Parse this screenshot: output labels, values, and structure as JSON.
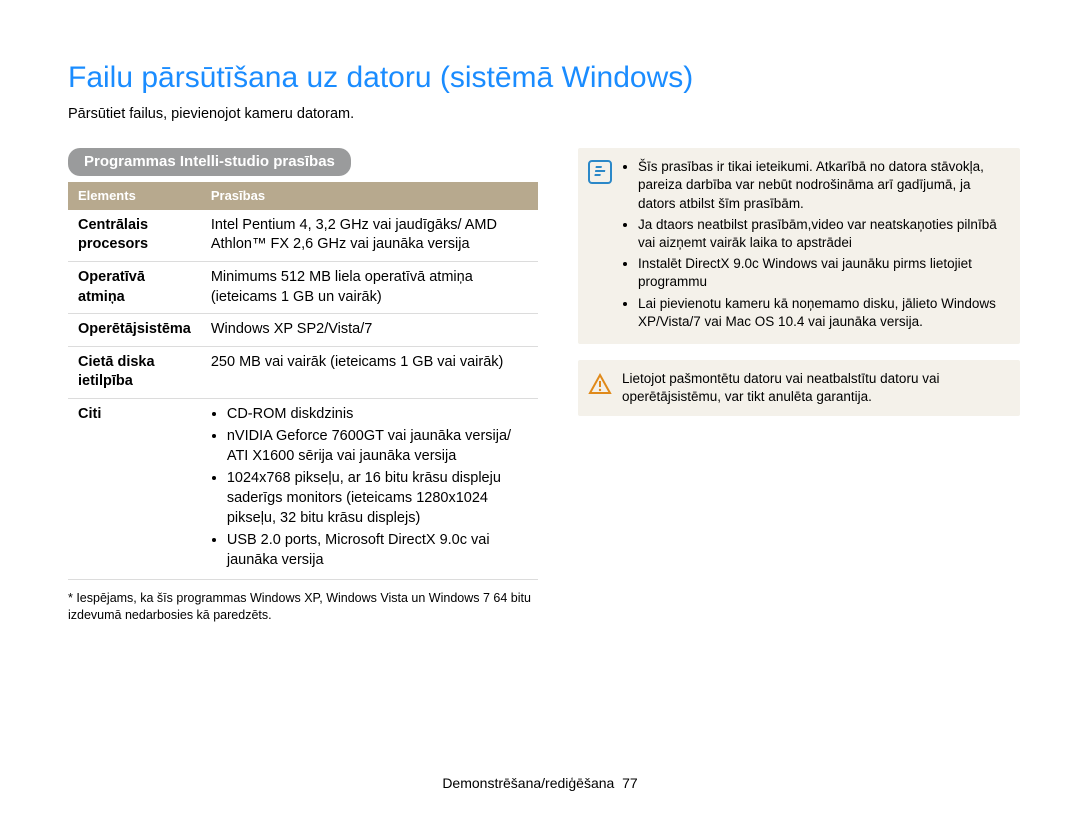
{
  "title": "Failu pārsūtīšana uz datoru (sistēmā Windows)",
  "intro": "Pārsūtiet failus, pievienojot kameru datoram.",
  "section_heading": "Programmas Intelli-studio prasības",
  "table": {
    "headers": {
      "el": "Elements",
      "req": "Prasības"
    },
    "rows": {
      "cpu": {
        "label": "Centrālais procesors",
        "value": "Intel Pentium 4, 3,2 GHz vai jaudīgāks/ AMD Athlon™ FX 2,6 GHz vai jaunāka versija"
      },
      "ram": {
        "label": "Operatīvā atmiņa",
        "value": "Minimums 512 MB liela operatīvā atmiņa (ieteicams 1 GB un vairāk)"
      },
      "os": {
        "label": "Operētājsistēma",
        "value": "Windows XP SP2/Vista/7"
      },
      "disk": {
        "label": "Cietā diska ietilpība",
        "value": "250 MB vai vairāk (ieteicams 1 GB vai vairāk)"
      },
      "other": {
        "label": "Citi",
        "items": [
          "CD-ROM diskdzinis",
          "nVIDIA Geforce 7600GT vai jaunāka versija/ ATI X1600 sērija vai jaunāka versija",
          "1024x768 pikseļu, ar 16 bitu krāsu displeju saderīgs monitors (ieteicams 1280x1024 pikseļu, 32 bitu krāsu displejs)",
          "USB 2.0 ports, Microsoft DirectX 9.0c vai jaunāka versija"
        ]
      }
    }
  },
  "footnote": "* Iespējams, ka šīs programmas Windows XP, Windows Vista un Windows 7 64 bitu izdevumā nedarbosies kā paredzēts.",
  "info_notes": [
    "Šīs prasības ir tikai ieteikumi. Atkarībā no datora stāvokļa, pareiza darbība var nebūt nodrošināma arī gadījumā, ja dators atbilst šīm prasībām.",
    "Ja dtaors neatbilst prasībām,video var neatskaņoties pilnībā vai aizņemt vairāk laika to apstrādei",
    "Instalēt DirectX 9.0c Windows vai jaunāku pirms lietojiet programmu",
    "Lai pievienotu kameru kā noņemamo disku, jālieto Windows XP/Vista/7 vai Mac OS 10.4 vai jaunāka versija."
  ],
  "warn_note": "Lietojot pašmontētu datoru vai neatbalstītu datoru vai operētājsistēmu, var tikt anulēta garantija.",
  "footer": {
    "section": "Demonstrēšana/rediģēšana",
    "page": "77"
  }
}
